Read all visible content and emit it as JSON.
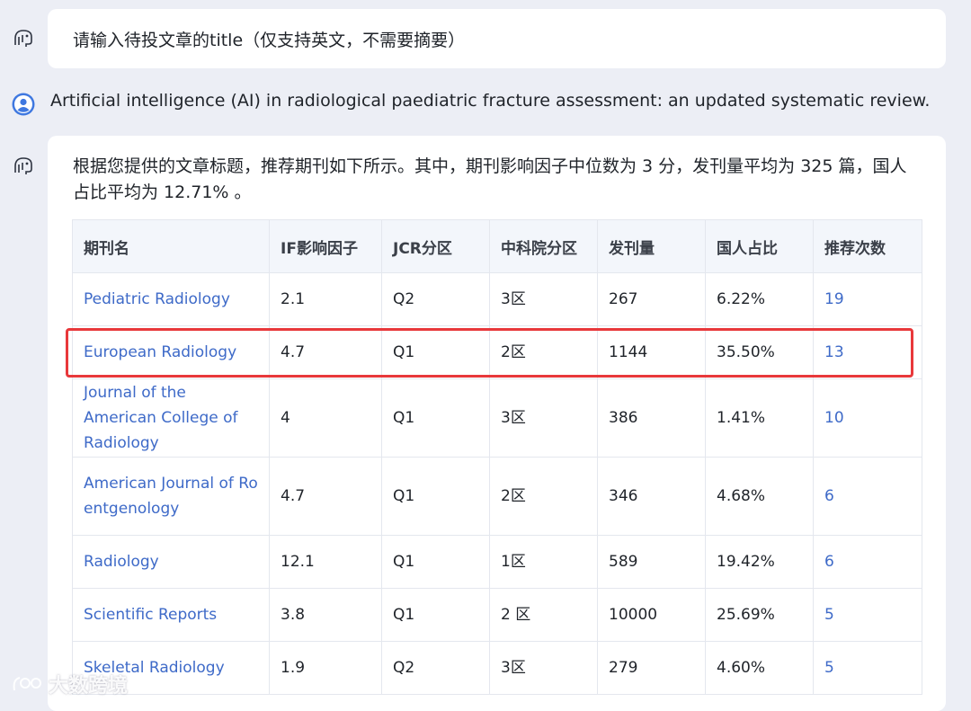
{
  "prompt": {
    "text": "请输入待投文章的title（仅支持英文，不需要摘要）"
  },
  "user_message": {
    "text": "Artificial intelligence (AI) in radiological paediatric fracture assessment: an updated systematic review."
  },
  "answer": {
    "summary": "根据您提供的文章标题，推荐期刊如下所示。其中，期刊影响因子中位数为 3 分，发刊量平均为 325 篇，国人占比平均为 12.71% 。",
    "columns": [
      "期刊名",
      "IF影响因子",
      "JCR分区",
      "中科院分区",
      "发刊量",
      "国人占比",
      "推荐次数"
    ],
    "rows": [
      {
        "name": "Pediatric Radiology",
        "if": "2.1",
        "jcr": "Q2",
        "cas": "3区",
        "volume": "267",
        "cn_ratio": "6.22%",
        "count": "19"
      },
      {
        "name": "European Radiology",
        "if": "4.7",
        "jcr": "Q1",
        "cas": "2区",
        "volume": "1144",
        "cn_ratio": "35.50%",
        "count": "13"
      },
      {
        "name": "Journal of the American College of Radiology",
        "if": "4",
        "jcr": "Q1",
        "cas": "3区",
        "volume": "386",
        "cn_ratio": "1.41%",
        "count": "10"
      },
      {
        "name": "American Journal of Roentgenology",
        "if": "4.7",
        "jcr": "Q1",
        "cas": "2区",
        "volume": "346",
        "cn_ratio": "4.68%",
        "count": "6"
      },
      {
        "name": "Radiology",
        "if": "12.1",
        "jcr": "Q1",
        "cas": "1区",
        "volume": "589",
        "cn_ratio": "19.42%",
        "count": "6"
      },
      {
        "name": "Scientific Reports",
        "if": "3.8",
        "jcr": "Q1",
        "cas": "2 区",
        "volume": "10000",
        "cn_ratio": "25.69%",
        "count": "5"
      },
      {
        "name": "Skeletal Radiology",
        "if": "1.9",
        "jcr": "Q2",
        "cas": "3区",
        "volume": "279",
        "cn_ratio": "4.60%",
        "count": "5"
      }
    ]
  },
  "watermark": {
    "text": "大数跨境"
  },
  "colors": {
    "link": "#3e6ac8",
    "highlight": "#e8383b",
    "header_bg": "#f3f6fb",
    "page_bg": "#eceef5"
  },
  "icons": [
    "bot-avatar-icon",
    "user-avatar-icon",
    "watermark-logo-icon"
  ]
}
